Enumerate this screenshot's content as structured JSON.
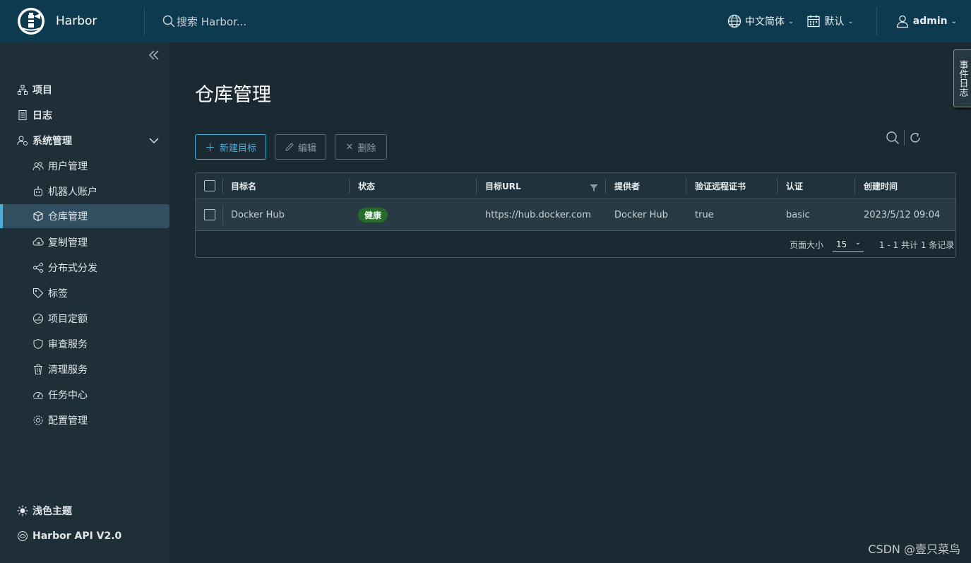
{
  "header": {
    "app_title": "Harbor",
    "search_placeholder": "搜索 Harbor...",
    "language": "中文简体",
    "theme": "默认",
    "user": "admin"
  },
  "sidebar": {
    "items": [
      {
        "label": "项目",
        "icon": "projects-icon"
      },
      {
        "label": "日志",
        "icon": "logs-icon"
      },
      {
        "label": "系统管理",
        "icon": "admin-icon"
      },
      {
        "label": "用户管理",
        "icon": "users-icon"
      },
      {
        "label": "机器人账户",
        "icon": "robot-icon"
      },
      {
        "label": "仓库管理",
        "icon": "registry-icon",
        "active": true
      },
      {
        "label": "复制管理",
        "icon": "replication-icon"
      },
      {
        "label": "分布式分发",
        "icon": "distribution-icon"
      },
      {
        "label": "标签",
        "icon": "tag-icon"
      },
      {
        "label": "项目定额",
        "icon": "quota-icon"
      },
      {
        "label": "审查服务",
        "icon": "shield-icon"
      },
      {
        "label": "清理服务",
        "icon": "trash-icon"
      },
      {
        "label": "任务中心",
        "icon": "dashboard-icon"
      },
      {
        "label": "配置管理",
        "icon": "gear-icon"
      }
    ],
    "bottom": {
      "theme_toggle": "浅色主题",
      "api": "Harbor API V2.0"
    }
  },
  "main": {
    "title": "仓库管理",
    "toolbar": {
      "new_label": "新建目标",
      "edit_label": "编辑",
      "delete_label": "删除"
    },
    "table": {
      "columns": [
        "目标名",
        "状态",
        "目标URL",
        "提供者",
        "验证远程证书",
        "认证",
        "创建时间"
      ],
      "rows": [
        {
          "name": "Docker Hub",
          "status": "健康",
          "url": "https://hub.docker.com",
          "provider": "Docker Hub",
          "verify_cert": "true",
          "auth": "basic",
          "created": "2023/5/12 09:04"
        }
      ]
    },
    "footer": {
      "page_size_label": "页面大小",
      "page_size": "15",
      "summary": "1 - 1 共计 1 条记录"
    }
  },
  "event_tab": "事件日志",
  "watermark": "CSDN @壹只菜鸟",
  "colors": {
    "header_bg": "#0e3a4f",
    "sidebar_bg": "#1f2f38",
    "main_bg": "#1b2a32",
    "accent": "#49afd9",
    "success_badge": "#266a2c"
  }
}
